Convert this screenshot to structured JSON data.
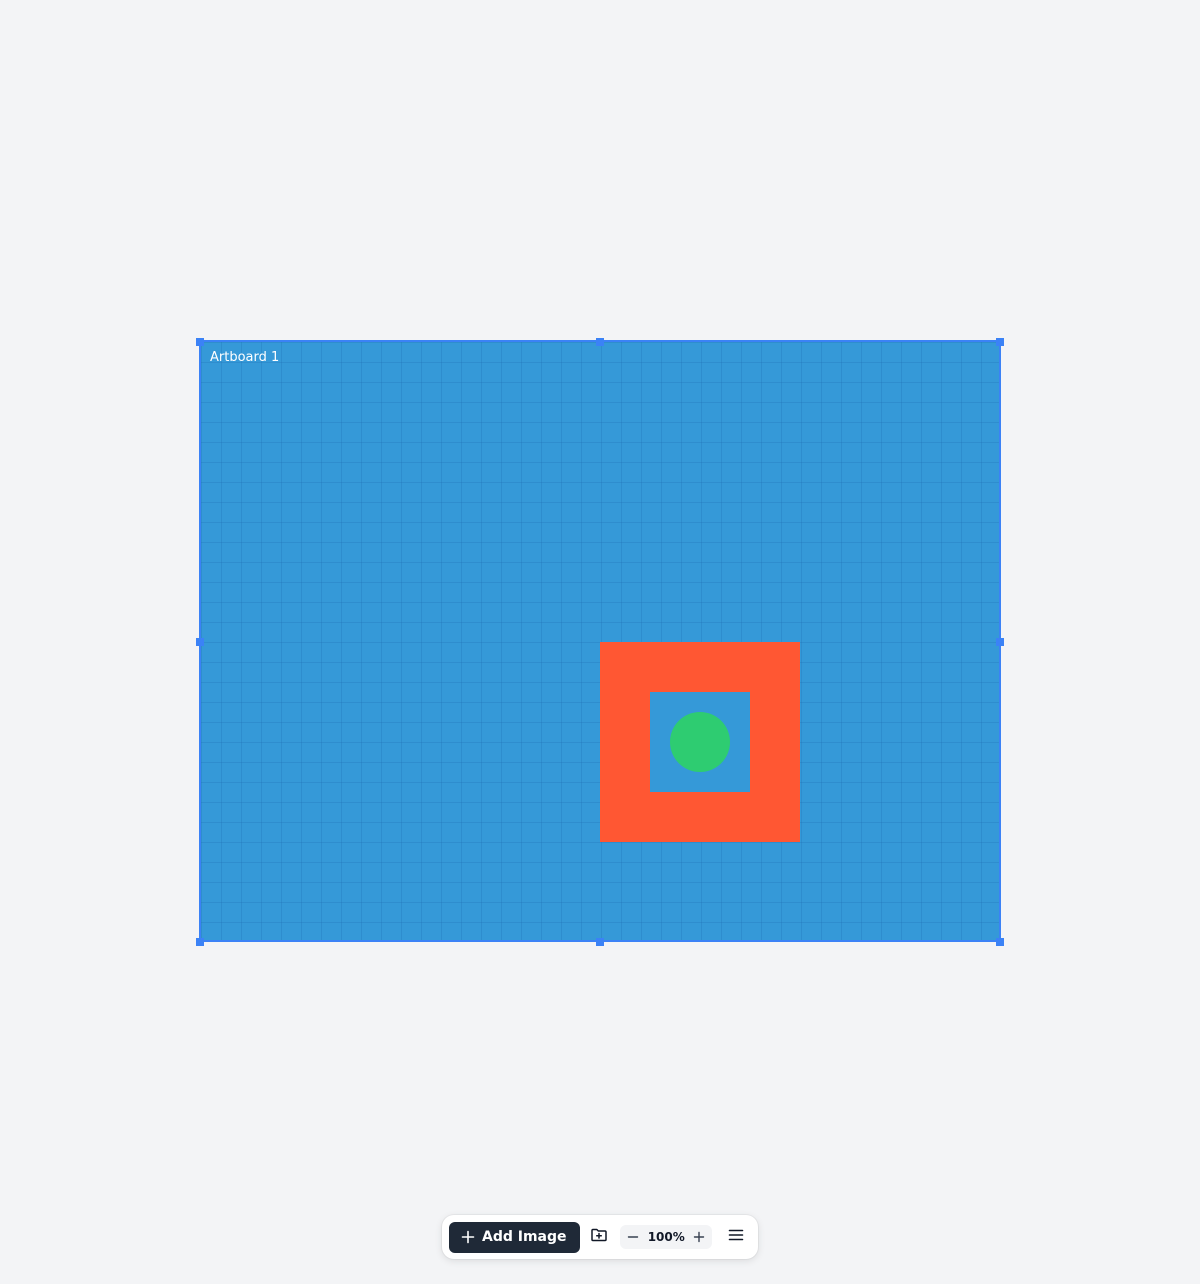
{
  "artboard": {
    "label": "Artboard 1",
    "background_color": "#3599d8",
    "selection_color": "#3b82f6",
    "shapes": [
      {
        "type": "square",
        "color": "#ff5733"
      },
      {
        "type": "square",
        "color": "#3599d8"
      },
      {
        "type": "circle",
        "color": "#2ecc71"
      }
    ]
  },
  "toolbar": {
    "add_image_label": "Add Image",
    "add_image_icon": "plus-icon",
    "folder_icon": "folder-plus-icon",
    "zoom_out_icon": "minus-icon",
    "zoom_level": "100%",
    "zoom_in_icon": "plus-icon",
    "menu_icon": "hamburger-menu-icon"
  }
}
